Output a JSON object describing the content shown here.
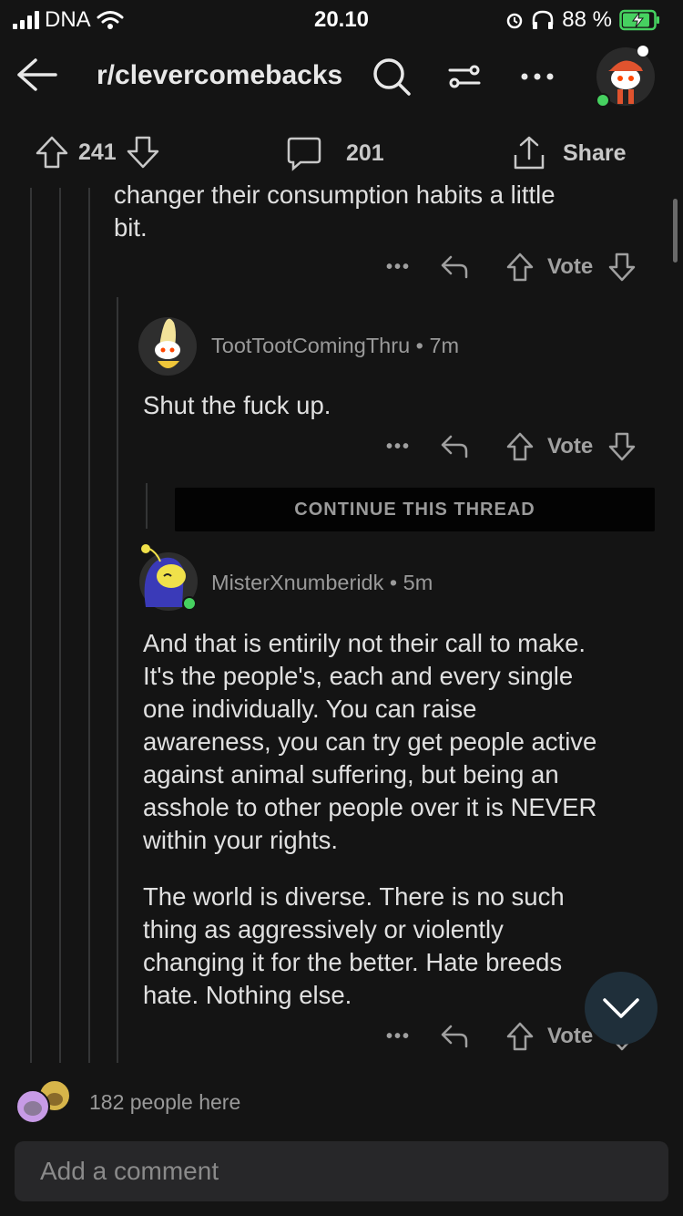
{
  "status_bar": {
    "carrier": "DNA",
    "time": "20.10",
    "battery_percent": "88 %",
    "battery_level": 0.88,
    "icons": [
      "signal-icon",
      "wifi-icon",
      "alarm-icon",
      "headphones-icon",
      "battery-charging-icon"
    ]
  },
  "nav": {
    "title": "r/clevercomebacks",
    "icons": [
      "back-arrow-icon",
      "search-icon",
      "sort-icon",
      "more-icon",
      "profile-avatar"
    ]
  },
  "post_bar": {
    "votes": "241",
    "comments": "201",
    "share_label": "Share"
  },
  "comments": [
    {
      "text_lines": [
        "changer their consumption habits a little",
        "bit."
      ],
      "vote_label": "Vote"
    },
    {
      "username": "TootTootComingThru",
      "age": "7m",
      "text_lines": [
        "Shut the fuck up."
      ],
      "vote_label": "Vote"
    },
    {
      "username": "MisterXnumberidk",
      "age": "5m",
      "text_lines": [
        "And that is entirily not their call to make.",
        "It's the people's, each and every single",
        "one individually. You can raise",
        "awareness, you can try get people active",
        "against animal suffering, but being an",
        "asshole to other people over it is NEVER",
        "within your rights."
      ],
      "text_lines_2": [
        "The world is diverse. There is no such",
        "thing as aggressively or violently",
        "changing it for the better. Hate breeds",
        "hate. Nothing else."
      ],
      "vote_label": "Vote"
    }
  ],
  "continue_thread_label": "CONTINUE THIS THREAD",
  "people_here": "182 people here",
  "comment_input_placeholder": "Add a comment",
  "colors": {
    "background": "#141414",
    "online_dot": "#46d160",
    "fab": "#1f2f3a",
    "input_bg": "#272729"
  }
}
